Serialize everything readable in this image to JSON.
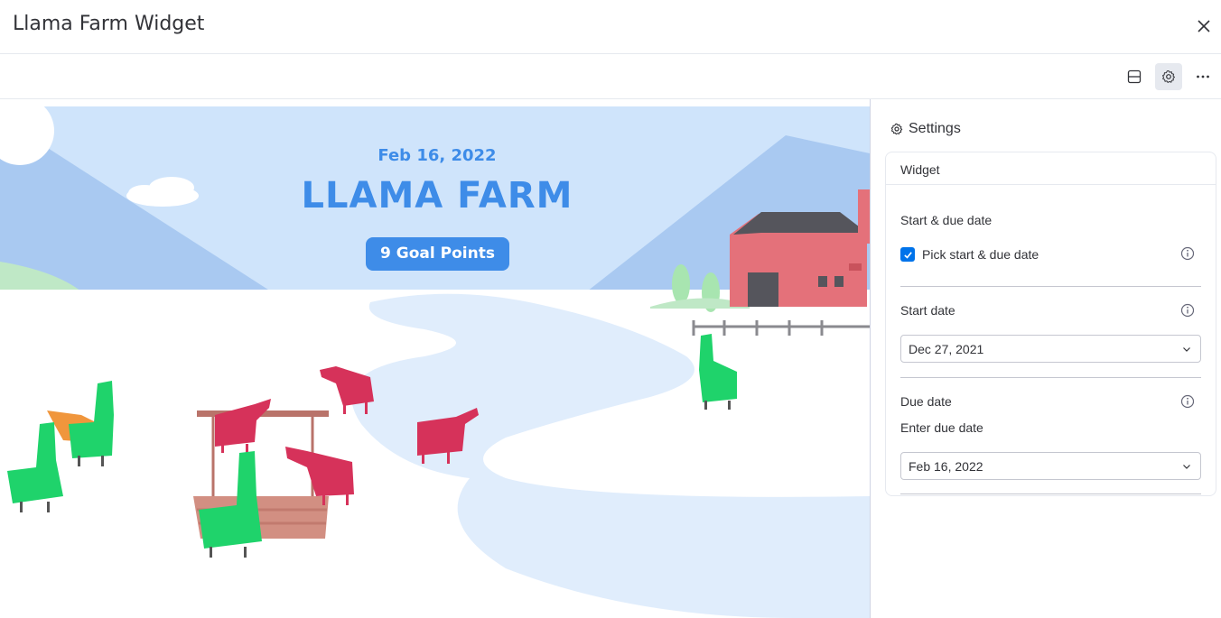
{
  "window": {
    "title": "Llama Farm Widget"
  },
  "toolbar": {
    "layout_icon": "layout-icon",
    "settings_icon": "gear-icon",
    "more_icon": "more-horizontal-icon"
  },
  "farm": {
    "date": "Feb 16, 2022",
    "title": "LLAMA FARM",
    "goal_badge": "9 Goal Points"
  },
  "settings": {
    "heading": "Settings",
    "card_title": "Widget",
    "start_due_label": "Start & due date",
    "pick_label": "Pick start & due date",
    "pick_checked": true,
    "start_date_label": "Start date",
    "start_date_value": "Dec 27, 2021",
    "due_date_label": "Due date",
    "due_date_hint": "Enter due date",
    "due_date_value": "Feb 16, 2022"
  },
  "colors": {
    "accent": "#0073ea",
    "llama_green": "#1fd36b",
    "llama_red": "#d6325a",
    "sky": "#cfe4fb",
    "barn": "#e4717a"
  }
}
